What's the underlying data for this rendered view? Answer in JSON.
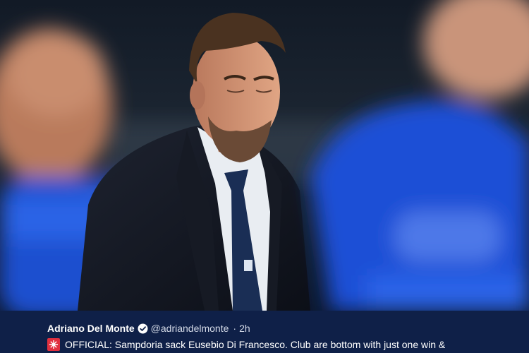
{
  "photo": {
    "description_icon": "photo-of-coach-in-suit"
  },
  "tweet": {
    "author_name": "Adriano Del Monte",
    "verified_icon": "verified-badge-icon",
    "handle": "@adriandelmonte",
    "separator": "·",
    "time": "2h",
    "flag_icon": "red-flag-icon",
    "text": "OFFICIAL: Sampdoria sack Eusebio Di Francesco. Club are bottom with just one win &"
  },
  "colors": {
    "bar_background": "#0f2048",
    "text": "#ffffff",
    "handle": "#d5dbe8",
    "kit_blue": "#1d4fd6"
  }
}
